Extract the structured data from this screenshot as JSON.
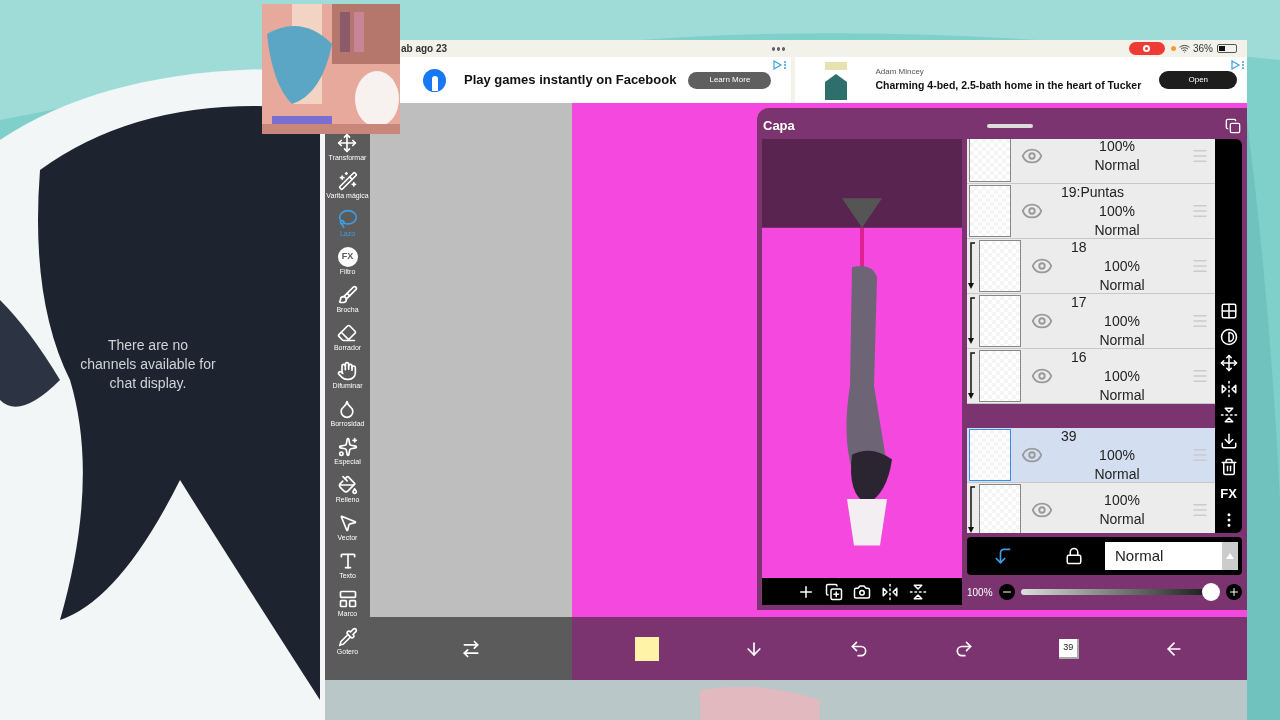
{
  "overlay_text": "There are no channels available for chat display.",
  "status_bar": {
    "date": "ab ago 23",
    "battery": "36%"
  },
  "ads": [
    {
      "title": "Play games instantly on Facebook",
      "button": "Learn More"
    },
    {
      "sponsor": "Adam Mincey",
      "title": "Charming 4-bed, 2.5-bath home in the heart of Tucker",
      "button": "Open"
    }
  ],
  "tools": [
    {
      "label": "Transformar",
      "selected": false
    },
    {
      "label": "Varita mágica",
      "selected": false
    },
    {
      "label": "Lazo",
      "selected": true
    },
    {
      "label": "Filtro",
      "selected": false,
      "icon_text": "FX"
    },
    {
      "label": "Brocha",
      "selected": false
    },
    {
      "label": "Borrador",
      "selected": false
    },
    {
      "label": "Difuminar",
      "selected": false
    },
    {
      "label": "Borrosidad",
      "selected": false
    },
    {
      "label": "Especial",
      "selected": false
    },
    {
      "label": "Relleno",
      "selected": false
    },
    {
      "label": "Vector",
      "selected": false
    },
    {
      "label": "Texto",
      "selected": false
    },
    {
      "label": "Marco",
      "selected": false
    },
    {
      "label": "Gotero",
      "selected": false
    }
  ],
  "layer_panel": {
    "title": "Capa",
    "layers": [
      {
        "opacity": "100%",
        "blend": "Normal",
        "selected": false,
        "clipped": false
      },
      {
        "name": "19:Puntas",
        "opacity": "100%",
        "blend": "Normal",
        "selected": false,
        "clipped": false
      },
      {
        "name": "18",
        "opacity": "100%",
        "blend": "Normal",
        "selected": false,
        "clipped": true
      },
      {
        "name": "17",
        "opacity": "100%",
        "blend": "Normal",
        "selected": false,
        "clipped": true
      },
      {
        "name": "16",
        "opacity": "100%",
        "blend": "Normal",
        "selected": false,
        "clipped": true
      },
      {
        "name": "39",
        "opacity": "100%",
        "blend": "Normal",
        "selected": true,
        "clipped": false
      },
      {
        "opacity": "100%",
        "blend": "Normal",
        "selected": false,
        "clipped": true
      }
    ],
    "side_fx": "FX",
    "blend_mode": "Normal",
    "opacity": {
      "reading": "100%",
      "level": 1
    }
  },
  "bottom_bar": {
    "color": "#fff3a8",
    "layer_count": "39"
  }
}
